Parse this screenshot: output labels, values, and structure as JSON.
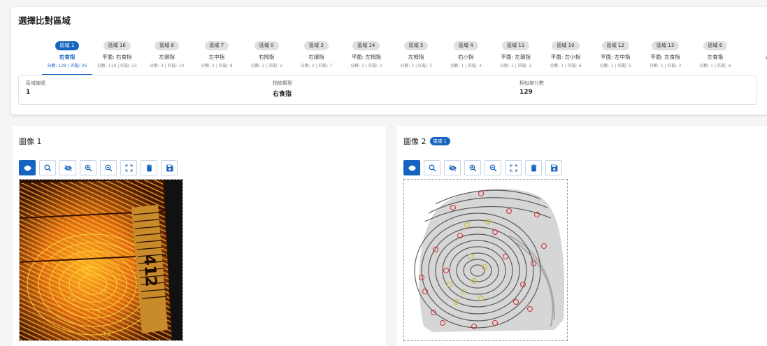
{
  "selection": {
    "title": "選擇比對區域",
    "tabs": [
      {
        "badge": "區域 1",
        "finger": "右食指",
        "score": "分數: 129 | 匹配: 25"
      },
      {
        "badge": "區域 16",
        "finger": "平面: 右食指",
        "score": "分數: 119 | 匹配: 23"
      },
      {
        "badge": "區域 8",
        "finger": "左環指",
        "score": "分數: 3 | 匹配: 10"
      },
      {
        "badge": "區域 7",
        "finger": "左中指",
        "score": "分數: 2 | 匹配: 8"
      },
      {
        "badge": "區域 0",
        "finger": "右拇指",
        "score": "分數: 2 | 匹配: 2"
      },
      {
        "badge": "區域 3",
        "finger": "右環指",
        "score": "分數: 2 | 匹配: 7"
      },
      {
        "badge": "區域 14",
        "finger": "平面: 左拇指",
        "score": "分數: 2 | 匹配: 2"
      },
      {
        "badge": "區域 5",
        "finger": "左拇指",
        "score": "分數: 2 | 匹配: 3"
      },
      {
        "badge": "區域 4",
        "finger": "右小指",
        "score": "分數: 1 | 匹配: 4"
      },
      {
        "badge": "區域 11",
        "finger": "平面: 左環指",
        "score": "分數: 1 | 匹配: 2"
      },
      {
        "badge": "區域 10",
        "finger": "平面: 左小指",
        "score": "分數: 1 | 匹配: 6"
      },
      {
        "badge": "區域 12",
        "finger": "平面: 左中指",
        "score": "分數: 1 | 匹配: 5"
      },
      {
        "badge": "區域 13",
        "finger": "平面: 左食指",
        "score": "分數: 1 | 匹配: 3"
      },
      {
        "badge": "區域 6",
        "finger": "左食指",
        "score": "分數: 1 | 匹配: 6"
      }
    ],
    "next_icon": "chevron-right-icon",
    "info": {
      "region_label": "區域編號",
      "region_value": "1",
      "type_label": "指紋類型",
      "type_value": "右食指",
      "score_label": "相似度分數",
      "score_value": "129"
    }
  },
  "image1": {
    "title": "圖像 1"
  },
  "image2": {
    "title": "圖像 2",
    "badge": "區域 1"
  },
  "toolbar_icons": [
    "eye-icon",
    "zoom-search-icon",
    "eye-off-icon",
    "zoom-in-icon",
    "zoom-out-icon",
    "fit-screen-icon",
    "delete-icon",
    "save-icon"
  ],
  "scale_text": "412",
  "colors": {
    "accent": "#1565c0",
    "minutia_red": "#d32f2f",
    "minutia_yellow": "#e8d84a"
  }
}
